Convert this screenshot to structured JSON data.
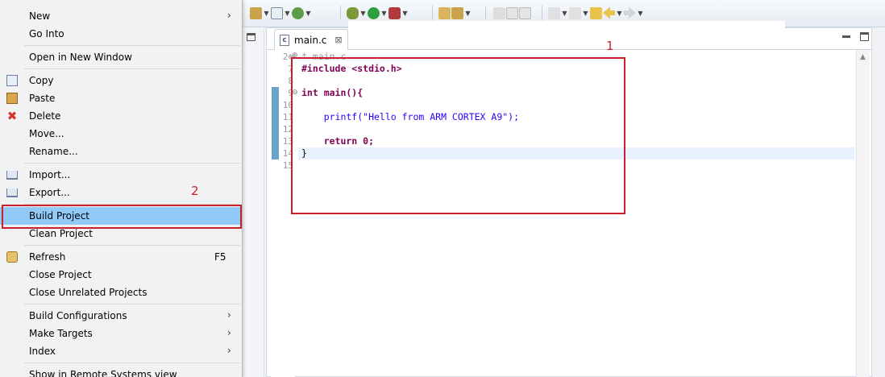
{
  "menu": {
    "items": [
      {
        "label": "New",
        "submenu": true
      },
      {
        "label": "Go Into"
      },
      {
        "label": "Open in New Window"
      },
      {
        "label": "Copy",
        "icon": "copy-icon"
      },
      {
        "label": "Paste",
        "icon": "paste-icon"
      },
      {
        "label": "Delete",
        "icon": "delete-icon"
      },
      {
        "label": "Move..."
      },
      {
        "label": "Rename..."
      },
      {
        "label": "Import...",
        "icon": "import-icon"
      },
      {
        "label": "Export...",
        "icon": "export-icon"
      },
      {
        "label": "Build Project",
        "highlighted": true
      },
      {
        "label": "Clean Project"
      },
      {
        "label": "Refresh",
        "icon": "refresh-icon",
        "accelerator": "F5"
      },
      {
        "label": "Close Project"
      },
      {
        "label": "Close Unrelated Projects"
      },
      {
        "label": "Build Configurations",
        "submenu": true
      },
      {
        "label": "Make Targets",
        "submenu": true
      },
      {
        "label": "Index",
        "submenu": true
      },
      {
        "label": "Show in Remote Systems view"
      }
    ],
    "submenu_arrow": "›",
    "highlight_color": "#91c9f7"
  },
  "editor": {
    "tab_label": "main.c",
    "tab_icon_letter": "c",
    "close_glyph": "⊠",
    "lines": [
      {
        "num": "2⊕",
        "text": "* main.c"
      },
      {
        "num": "7",
        "text": "#include <stdio.h>"
      },
      {
        "num": "8",
        "text": ""
      },
      {
        "num": "9",
        "text": "int main(){"
      },
      {
        "num": "10",
        "text": ""
      },
      {
        "num": "11",
        "text": "    printf(\"Hello from ARM CORTEX A9\");"
      },
      {
        "num": "12",
        "text": ""
      },
      {
        "num": "13",
        "text": "    return 0;"
      },
      {
        "num": "14",
        "text": "}"
      },
      {
        "num": "15",
        "text": ""
      }
    ],
    "keyword_color": "#7f0055",
    "string_color": "#2a00ff"
  },
  "annotations": {
    "label_1": "1",
    "label_2": "2",
    "color": "#cc1f2c"
  }
}
